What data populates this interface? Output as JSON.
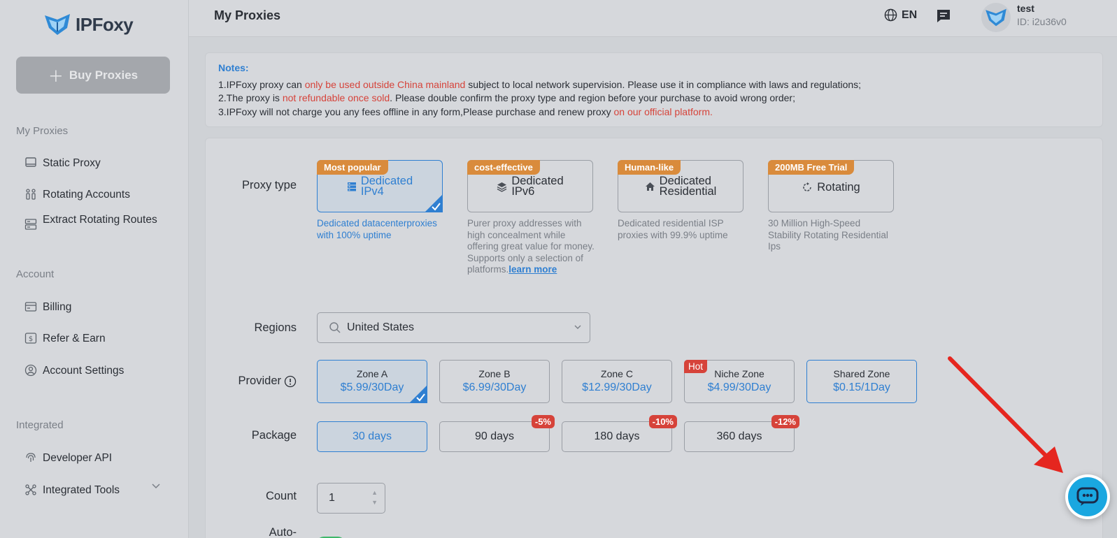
{
  "brand": {
    "name": "IPFoxy"
  },
  "sidebar": {
    "buy_label": "Buy Proxies",
    "sections": {
      "my_proxies": "My Proxies",
      "account": "Account",
      "integrated": "Integrated"
    },
    "items": [
      {
        "label": "Static Proxy",
        "icon": "laptop-icon"
      },
      {
        "label": "Rotating Accounts",
        "icon": "rotating-accounts-icon"
      },
      {
        "label": "Extract Rotating Routes",
        "icon": "server-icon"
      },
      {
        "label": "Billing",
        "icon": "billing-icon"
      },
      {
        "label": "Refer & Earn",
        "icon": "dollar-icon"
      },
      {
        "label": "Account Settings",
        "icon": "user-circle-icon"
      },
      {
        "label": "Developer API",
        "icon": "fingerprint-icon"
      },
      {
        "label": "Integrated Tools",
        "icon": "tools-icon"
      }
    ]
  },
  "header": {
    "title": "My Proxies",
    "language": "EN",
    "user_name": "test",
    "user_id": "ID: i2u36v0"
  },
  "notes": {
    "title": "Notes:",
    "line1_a": "1.IPFoxy proxy can ",
    "line1_b": "only be used outside China mainland",
    "line1_c": " subject to local network supervision. Please use it in compliance with laws and regulations;",
    "line2_a": "2.The proxy is ",
    "line2_b": "not refundable once sold",
    "line2_c": ". Please double confirm the proxy type and region before your purchase to avoid wrong order;",
    "line3_a": "3.IPFoxy will not charge you any fees offline in any form,Please purchase and renew proxy ",
    "line3_b": "on our official platform."
  },
  "form": {
    "labels": {
      "proxy_type": "Proxy type",
      "regions": "Regions",
      "provider": "Provider",
      "package": "Package",
      "count": "Count",
      "auto": "Auto-"
    },
    "proxy_types": [
      {
        "tag": "Most popular",
        "name_1": "Dedicated",
        "name_2": "IPv4",
        "desc": "Dedicated datacenterproxies with 100% uptime",
        "selected": true
      },
      {
        "tag": "cost-effective",
        "name_1": "Dedicated",
        "name_2": "IPv6",
        "desc": "Purer proxy addresses with high concealment while offering great value for money. Supports only a selection of platforms.",
        "link": "learn more",
        "selected": false
      },
      {
        "tag": "Human-like",
        "name_1": "Dedicated",
        "name_2": "Residential",
        "desc": "Dedicated residential ISP proxies with 99.9% uptime",
        "selected": false
      },
      {
        "tag": "200MB Free Trial",
        "name_1": "Rotating",
        "desc": "30 Million High-Speed Stability Rotating Residential Ips",
        "selected": false
      }
    ],
    "region_value": "United States",
    "zones": [
      {
        "name": "Zone A",
        "price": "$5.99/30Day",
        "selected": true
      },
      {
        "name": "Zone B",
        "price": "$6.99/30Day"
      },
      {
        "name": "Zone C",
        "price": "$12.99/30Day"
      },
      {
        "name": "Niche Zone",
        "price": "$4.99/30Day",
        "badge": "Hot"
      },
      {
        "name": "Shared Zone",
        "price": "$0.15/1Day"
      }
    ],
    "packages": [
      {
        "label": "30 days",
        "selected": true
      },
      {
        "label": "90 days",
        "discount": "-5%"
      },
      {
        "label": "180 days",
        "discount": "-10%"
      },
      {
        "label": "360 days",
        "discount": "-12%"
      }
    ],
    "count_value": "1"
  },
  "colors": {
    "accent": "#2f7fd1",
    "danger": "#d6433a",
    "tag": "#d98b3c",
    "chat": "#1aa7e0"
  }
}
